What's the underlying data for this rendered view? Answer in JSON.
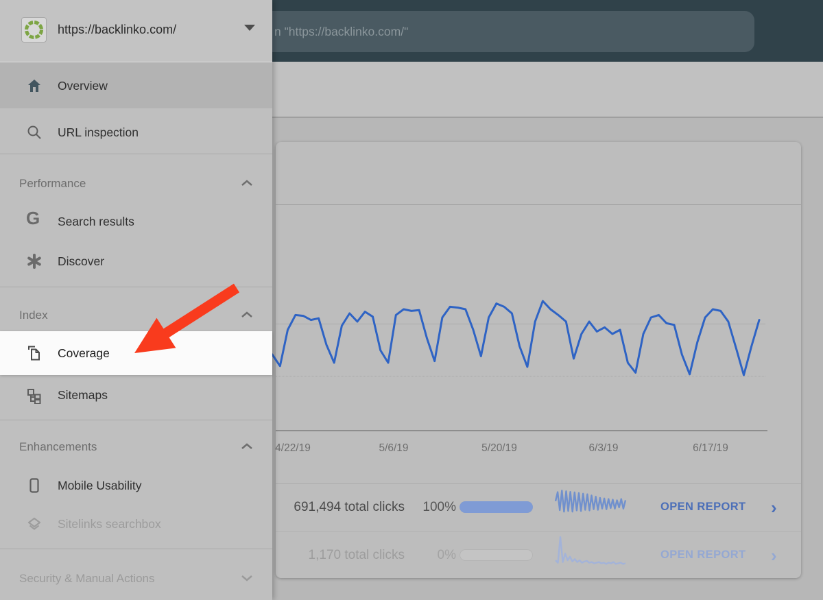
{
  "topbar": {
    "search_text_visible": "n \"https://backlinko.com/\""
  },
  "property_selector": {
    "url": "https://backlinko.com/",
    "icon": "segmented-ring-icon",
    "ring_color": "#7da544"
  },
  "sidebar": {
    "items_top": [
      {
        "label": "Overview",
        "icon": "home-icon"
      },
      {
        "label": "URL inspection",
        "icon": "search-icon"
      }
    ],
    "sections": [
      {
        "label": "Performance",
        "chevron": "up",
        "items": [
          {
            "label": "Search results",
            "icon": "google-g-icon"
          },
          {
            "label": "Discover",
            "icon": "asterisk-icon"
          }
        ]
      },
      {
        "label": "Index",
        "chevron": "up",
        "items": [
          {
            "label": "Coverage",
            "icon": "pages-icon",
            "highlighted": true
          },
          {
            "label": "Sitemaps",
            "icon": "sitemap-icon"
          }
        ]
      },
      {
        "label": "Enhancements",
        "chevron": "up",
        "items": [
          {
            "label": "Mobile Usability",
            "icon": "phone-icon"
          },
          {
            "label": "Sitelinks searchbox",
            "icon": "layers-icon",
            "faded": true
          }
        ]
      },
      {
        "label": "Security & Manual Actions",
        "chevron": "down",
        "items": []
      }
    ]
  },
  "annotation": {
    "type": "red-arrow",
    "points_to": "Coverage",
    "color": "#f93b1d"
  },
  "chart_data": {
    "type": "line",
    "title": "Performance over time (clicks) — value axis hidden behind menu overlay",
    "x_tick_labels": [
      "4/22/19",
      "5/6/19",
      "5/20/19",
      "6/3/19",
      "6/17/19"
    ],
    "x_start_date": "4/19/19",
    "x_step_days": 1,
    "grid": "horizontal",
    "legend": "none",
    "line_color": "#2e63c4",
    "series": [
      {
        "name": "Clicks",
        "values_relative_0_100": [
          30,
          16,
          60,
          78,
          77,
          72,
          74,
          42,
          20,
          65,
          80,
          70,
          82,
          76,
          35,
          20,
          78,
          85,
          83,
          84,
          50,
          22,
          75,
          88,
          87,
          85,
          60,
          28,
          75,
          92,
          88,
          80,
          40,
          15,
          70,
          95,
          85,
          78,
          70,
          25,
          55,
          70,
          58,
          63,
          55,
          60,
          20,
          8,
          55,
          75,
          78,
          68,
          66,
          30,
          6,
          45,
          75,
          85,
          83,
          70,
          38,
          5,
          40,
          72
        ]
      }
    ]
  },
  "report_table": {
    "rows": [
      {
        "clicks": "691,494 total clicks",
        "percent": "100%",
        "progress": 100,
        "open_report": "OPEN REPORT",
        "chevron": "›",
        "spark_values": [
          55,
          85,
          25,
          90,
          20,
          88,
          22,
          86,
          20,
          84,
          24,
          82,
          22,
          80,
          26,
          78,
          24,
          74,
          28,
          70,
          26,
          66,
          30,
          64,
          28,
          62,
          32,
          60,
          30,
          58,
          34,
          62,
          30,
          58
        ]
      },
      {
        "clicks": "1,170 total clicks",
        "percent": "0%",
        "progress": 0,
        "open_report": "OPEN REPORT",
        "chevron": "›",
        "spark_values": [
          18,
          10,
          95,
          12,
          40,
          18,
          30,
          14,
          22,
          12,
          18,
          10,
          14,
          16,
          10,
          12,
          8,
          10,
          12,
          8,
          10,
          6,
          10,
          8,
          12,
          6,
          8,
          10,
          6,
          8
        ]
      }
    ]
  }
}
